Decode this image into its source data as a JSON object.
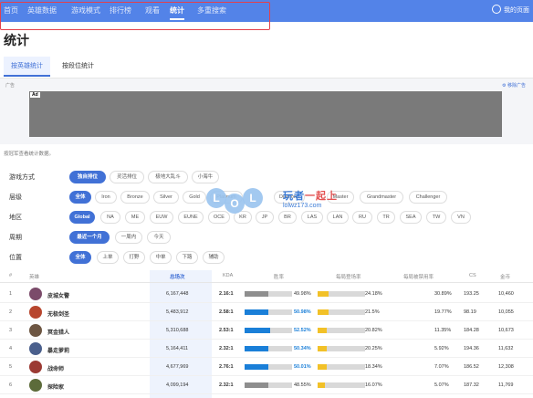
{
  "nav": {
    "items": [
      "首页",
      "英雄数据",
      "游戏模式",
      "排行榜",
      "观看",
      "统计",
      "多重搜索"
    ],
    "active_index": 5,
    "my_page": "我的页面"
  },
  "page": {
    "title": "统计"
  },
  "tabs": [
    "按英雄统计",
    "按段位统计"
  ],
  "ad": {
    "label": "广告",
    "remove": "移除广告",
    "badge": "Ad"
  },
  "note": "按冠军查看统计数据。",
  "filters": [
    {
      "label": "游戏方式",
      "options": [
        "独自排位",
        "灵活排位",
        "极地大乱斗",
        "小海牛"
      ],
      "selected": 0
    },
    {
      "label": "层级",
      "options": [
        "全体",
        "Iron",
        "Bronze",
        "Silver",
        "Gold",
        "Platinum",
        "Diamond",
        "Master",
        "Grandmaster",
        "Challenger"
      ],
      "selected": 0
    },
    {
      "label": "地区",
      "options": [
        "Global",
        "NA",
        "ME",
        "EUW",
        "EUNE",
        "OCE",
        "KR",
        "JP",
        "BR",
        "LAS",
        "LAN",
        "RU",
        "TR",
        "SEA",
        "TW",
        "VN"
      ],
      "selected": 0
    },
    {
      "label": "周期",
      "options": [
        "最近一个月",
        "一周内",
        "今天"
      ],
      "selected": 0
    },
    {
      "label": "位置",
      "options": [
        "全体",
        "上单",
        "打野",
        "中单",
        "下路",
        "辅助"
      ],
      "selected": 0
    }
  ],
  "watermark": {
    "logo": [
      "L",
      "O",
      "L"
    ],
    "text_a": "玩者",
    "text_b": "一起上",
    "url": "lolwz173.com"
  },
  "table": {
    "headers": [
      "#",
      "英雄",
      "总场次",
      "KDA",
      "胜率",
      "每局登场率",
      "每局被禁用率",
      "CS",
      "金币"
    ],
    "rows": [
      {
        "rank": "1",
        "name": "皮城女警",
        "games": "6,167,448",
        "kda": "2.16:1",
        "winrate": "49.98%",
        "win_pct": 49.98,
        "pick": "24.18%",
        "pick_pct": 24.18,
        "ban": "30.89%",
        "cs": "193.25",
        "gold": "10,460",
        "icon_color": "#7b4b6a"
      },
      {
        "rank": "2",
        "name": "无极剑圣",
        "games": "5,483,912",
        "kda": "2.58:1",
        "winrate": "50.98%",
        "win_pct": 50.98,
        "pick": "21.5%",
        "pick_pct": 21.5,
        "ban": "19.77%",
        "cs": "98.19",
        "gold": "10,055",
        "icon_color": "#b8462e"
      },
      {
        "rank": "3",
        "name": "冥金猎人",
        "games": "5,310,688",
        "kda": "2.53:1",
        "winrate": "52.52%",
        "win_pct": 52.52,
        "pick": "20.82%",
        "pick_pct": 20.82,
        "ban": "11.35%",
        "cs": "184.28",
        "gold": "10,673",
        "icon_color": "#6d5642"
      },
      {
        "rank": "4",
        "name": "暴走萝莉",
        "games": "5,164,411",
        "kda": "2.32:1",
        "winrate": "50.34%",
        "win_pct": 50.34,
        "pick": "20.25%",
        "pick_pct": 20.25,
        "ban": "5.92%",
        "cs": "194.36",
        "gold": "11,632",
        "icon_color": "#4a5f8c"
      },
      {
        "rank": "5",
        "name": "战命师",
        "games": "4,677,969",
        "kda": "2.76:1",
        "winrate": "50.01%",
        "win_pct": 50.01,
        "pick": "18.34%",
        "pick_pct": 18.34,
        "ban": "7.07%",
        "cs": "186.52",
        "gold": "12,308",
        "icon_color": "#9b3a33"
      },
      {
        "rank": "6",
        "name": "探险家",
        "games": "4,099,194",
        "kda": "2.32:1",
        "winrate": "48.55%",
        "win_pct": 48.55,
        "pick": "16.07%",
        "pick_pct": 16.07,
        "ban": "5.07%",
        "cs": "187.32",
        "gold": "11,769",
        "icon_color": "#5c6b3a"
      }
    ]
  }
}
